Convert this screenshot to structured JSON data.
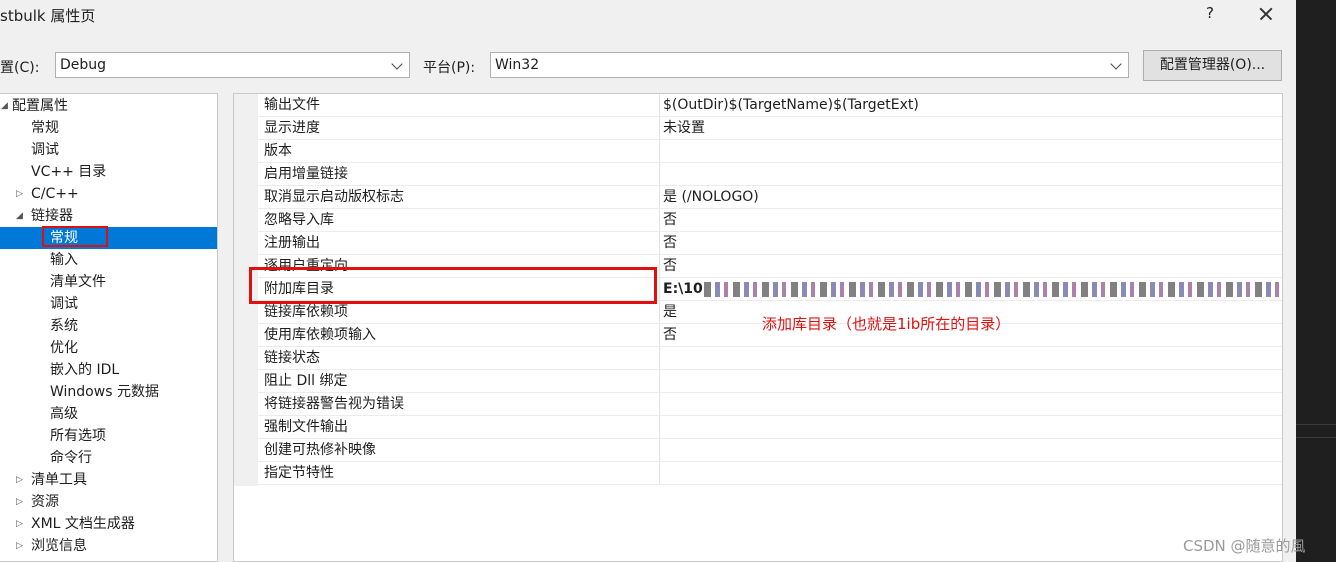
{
  "window": {
    "title": "stbulk 属性页",
    "help_label": "?",
    "close_label": "✕"
  },
  "config": {
    "label": "置(C):",
    "value": "Debug",
    "platform_label": "平台(P):",
    "platform_value": "Win32",
    "manager_button": "配置管理器(O)..."
  },
  "tree": [
    {
      "label": "配置属性",
      "arrow": "◢"
    },
    {
      "label": "常规"
    },
    {
      "label": "调试"
    },
    {
      "label": "VC++ 目录"
    },
    {
      "label": "C/C++",
      "arrow": "▷"
    },
    {
      "label": "链接器",
      "arrow": "◢"
    },
    {
      "label": "常规",
      "selected": true
    },
    {
      "label": "输入"
    },
    {
      "label": "清单文件"
    },
    {
      "label": "调试"
    },
    {
      "label": "系统"
    },
    {
      "label": "优化"
    },
    {
      "label": "嵌入的 IDL"
    },
    {
      "label": "Windows 元数据"
    },
    {
      "label": "高级"
    },
    {
      "label": "所有选项"
    },
    {
      "label": "命令行"
    },
    {
      "label": "清单工具",
      "arrow": "▷"
    },
    {
      "label": "资源",
      "arrow": "▷"
    },
    {
      "label": "XML 文档生成器",
      "arrow": "▷"
    },
    {
      "label": "浏览信息",
      "arrow": "▷"
    }
  ],
  "properties": [
    {
      "name": "输出文件",
      "value": "$(OutDir)$(TargetName)$(TargetExt)"
    },
    {
      "name": "显示进度",
      "value": "未设置"
    },
    {
      "name": "版本",
      "value": ""
    },
    {
      "name": "启用增量链接",
      "value": ""
    },
    {
      "name": "取消显示启动版权标志",
      "value": "是 (/NOLOGO)"
    },
    {
      "name": "忽略导入库",
      "value": "否"
    },
    {
      "name": "注册输出",
      "value": "否"
    },
    {
      "name": "逐用户重定向",
      "value": "否"
    },
    {
      "name": "附加库目录",
      "value": "E:\\10",
      "obscured": true
    },
    {
      "name": "链接库依赖项",
      "value": "是"
    },
    {
      "name": "使用库依赖项输入",
      "value": "否"
    },
    {
      "name": "链接状态",
      "value": ""
    },
    {
      "name": "阻止 Dll 绑定",
      "value": ""
    },
    {
      "name": "将链接器警告视为错误",
      "value": ""
    },
    {
      "name": "强制文件输出",
      "value": ""
    },
    {
      "name": "创建可热修补映像",
      "value": ""
    },
    {
      "name": "指定节特性",
      "value": ""
    }
  ],
  "annotation": "添加库目录（也就是1ib所在的目录）",
  "watermark": "CSDN @随意的風"
}
